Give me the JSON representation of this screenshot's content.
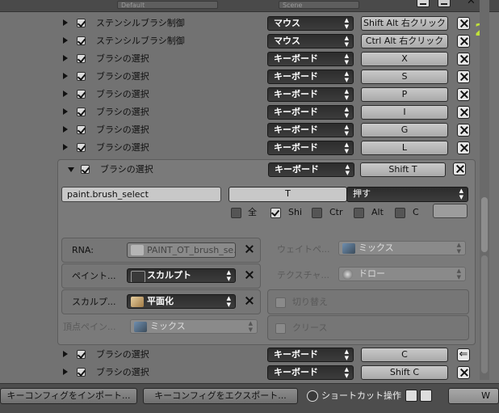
{
  "top_strip": {
    "field1": "Default",
    "field2": "Scene"
  },
  "rows_top": [
    {
      "label": "ステンシルブラシ制御",
      "input_type": "マウス",
      "key": "Shift Alt 右クリック"
    },
    {
      "label": "ステンシルブラシ制御",
      "input_type": "マウス",
      "key": "Ctrl Alt 右クリック"
    },
    {
      "label": "ブラシの選択",
      "input_type": "キーボード",
      "key": "X"
    },
    {
      "label": "ブラシの選択",
      "input_type": "キーボード",
      "key": "S"
    },
    {
      "label": "ブラシの選択",
      "input_type": "キーボード",
      "key": "P"
    },
    {
      "label": "ブラシの選択",
      "input_type": "キーボード",
      "key": "I"
    },
    {
      "label": "ブラシの選択",
      "input_type": "キーボード",
      "key": "G"
    },
    {
      "label": "ブラシの選択",
      "input_type": "キーボード",
      "key": "L"
    }
  ],
  "expanded": {
    "label": "ブラシの選択",
    "input_type": "キーボード",
    "key": "Shift T",
    "operator_id": "paint.brush_select",
    "key_field": "T",
    "event_value": "押す",
    "modifiers": {
      "any": "全",
      "shift": "Shi",
      "ctrl": "Ctr",
      "alt": "Alt",
      "cmd": "C"
    },
    "props": {
      "rna_label": "RNA:",
      "rna_value": "PAINT_OT_brush_se...",
      "paint_label": "ペイント...",
      "paint_value": "スカルプト",
      "sculpt_label": "スカルプ...",
      "sculpt_value": "平面化",
      "vertex_label": "頂点ペイン...",
      "vertex_value": "ミックス",
      "weight_label": "ウェイトペ...",
      "weight_value": "ミックス",
      "texture_label": "テクスチャ...",
      "texture_value": "ドロー",
      "toggle_label": "切り替え",
      "create_label": "クリース"
    }
  },
  "rows_bottom": [
    {
      "label": "ブラシの選択",
      "input_type": "キーボード",
      "key": "C"
    },
    {
      "label": "ブラシの選択",
      "input_type": "キーボード",
      "key": "Shift C"
    }
  ],
  "bottom": {
    "import_label": "キーコンフィグをインポート...",
    "export_label": "キーコンフィグをエクスポート...",
    "shortcut_label": "ショートカット操作",
    "right_field": "W"
  },
  "corner_number": "2",
  "colors": {
    "accent_green": "#c0e23a",
    "menu_dark": "#2f2f2f",
    "panel_bg": "#7a7a7a"
  }
}
